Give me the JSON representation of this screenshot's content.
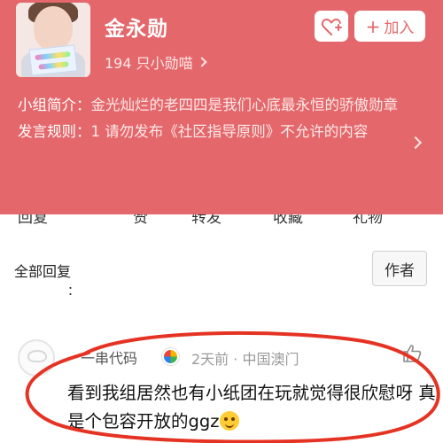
{
  "group": {
    "name": "金永勋",
    "member_count": "194 只小勋喵",
    "join_button": "加入",
    "intro_label": "小组简介：",
    "intro_text": "金光灿烂的老四四是我们心底最永恒的骄傲勋章",
    "rules_label": "发言规则：",
    "rules_text": "1 请勿发布《社区指导原则》不允许的内容"
  },
  "tabs": [
    "回复",
    "赞",
    "转发",
    "收藏",
    "礼物"
  ],
  "comments_section": {
    "all_replies_label": "全部回复",
    "author_only_button": "作者",
    "dots": "："
  },
  "comment": {
    "user": "一串代码",
    "time": "2天前",
    "separator": "·",
    "location": "中国澳门",
    "text": "看到我组居然也有小纸团在玩就觉得很欣慰呀 真是个包容开放的ggz"
  },
  "colors": {
    "header_bg": "#e4686b",
    "annotation_red": "#e53323"
  },
  "icons": {
    "follow": "heart-plus-icon",
    "like": "thumbs-up-icon",
    "badge": "multicolor-badge-icon",
    "emoji": "grinning-face-icon"
  }
}
